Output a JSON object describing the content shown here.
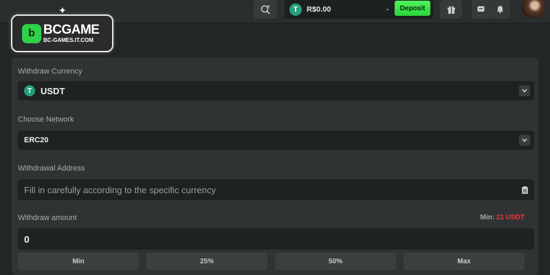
{
  "header": {
    "currency_icon": "tether-icon",
    "balance": "R$0.00",
    "deposit_label": "Deposit"
  },
  "logo": {
    "name": "BCGAME",
    "site": "BC-GAMES.IT.COM"
  },
  "form": {
    "currency_label": "Withdraw Currency",
    "currency_value": "USDT",
    "network_label": "Choose Network",
    "network_value": "ERC20",
    "address_label": "Withdrawal Address",
    "address_placeholder": "Fill in carefully according to the specific currency",
    "amount_label": "Withdraw amount",
    "min_label": "Min:",
    "min_value": "21 USDT",
    "amount_value": "0",
    "quick_buttons": [
      "Min",
      "25%",
      "50%",
      "Max"
    ]
  },
  "colors": {
    "deposit_green": "#2ad63a",
    "tether_green": "#26a17b",
    "min_red": "#e8383b",
    "background": "#232626",
    "panel": "#303333"
  }
}
